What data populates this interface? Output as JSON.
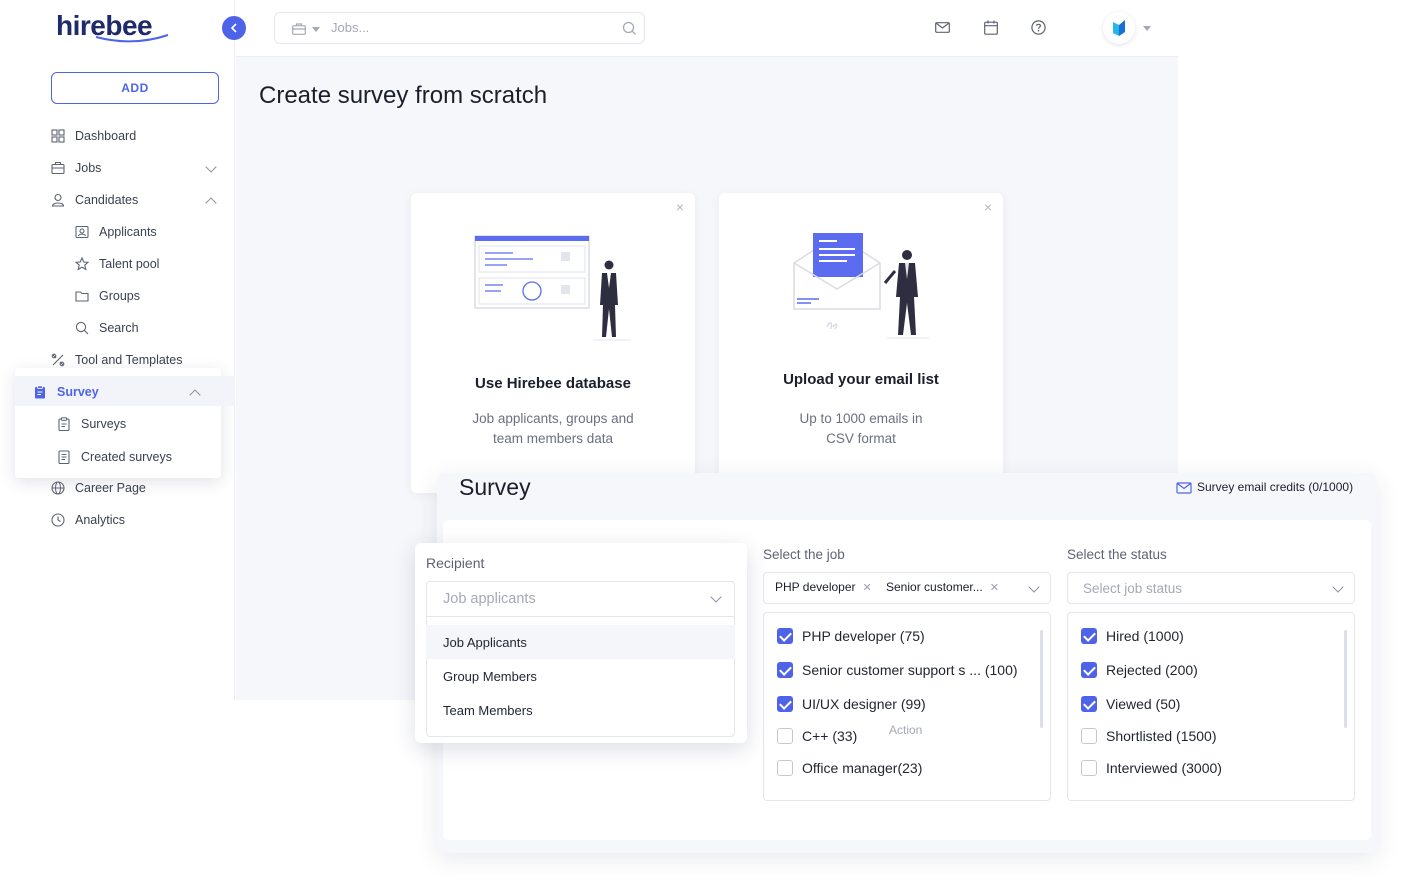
{
  "app": {
    "logo": "hirebee"
  },
  "sidebar": {
    "add_label": "ADD",
    "items": [
      {
        "label": "Dashboard",
        "icon": "grid-icon"
      },
      {
        "label": "Jobs",
        "icon": "briefcase-icon"
      },
      {
        "label": "Candidates",
        "icon": "user-icon"
      },
      {
        "label": "Applicants",
        "icon": "id-card-icon"
      },
      {
        "label": "Talent pool",
        "icon": "star-icon"
      },
      {
        "label": "Groups",
        "icon": "folder-icon"
      },
      {
        "label": "Search",
        "icon": "search-icon"
      },
      {
        "label": "Tool and Templates",
        "icon": "tools-icon"
      },
      {
        "label": "Career Page",
        "icon": "globe-icon"
      },
      {
        "label": "Analytics",
        "icon": "clock-icon"
      }
    ],
    "survey_menu": {
      "title": "Survey",
      "items": [
        {
          "label": "Surveys"
        },
        {
          "label": "Created surveys"
        }
      ]
    }
  },
  "topbar": {
    "search_placeholder": "Jobs...",
    "icons": [
      "mail-icon",
      "calendar-icon",
      "help-icon",
      "avatar"
    ]
  },
  "main": {
    "title": "Create survey from scratch",
    "cards": [
      {
        "title": "Use Hirebee database",
        "subtitle_line1": "Job applicants, groups and",
        "subtitle_line2": "team members data"
      },
      {
        "title": "Upload your email list",
        "subtitle_line1": "Up to 1000 emails in",
        "subtitle_line2": "CSV format"
      }
    ]
  },
  "survey": {
    "title": "Survey",
    "credits": "Survey email credits (0/1000)",
    "recipient": {
      "label": "Recipient",
      "placeholder": "Job applicants",
      "options": [
        "Job Applicants",
        "Group Members",
        "Team Members"
      ]
    },
    "job": {
      "label": "Select the job",
      "tags": [
        "PHP developer",
        "Senior customer..."
      ],
      "options": [
        {
          "label": "PHP developer (75)",
          "checked": true
        },
        {
          "label": "Senior customer support s ... (100)",
          "checked": true
        },
        {
          "label": "UI/UX designer (99)",
          "checked": true
        },
        {
          "label": "C++ (33)",
          "checked": false
        },
        {
          "label": "Office manager(23)",
          "checked": false
        }
      ],
      "action_label": "Action"
    },
    "status": {
      "label": "Select the status",
      "placeholder": "Select job status",
      "options": [
        {
          "label": "Hired (1000)",
          "checked": true
        },
        {
          "label": "Rejected (200)",
          "checked": true
        },
        {
          "label": "Viewed (50)",
          "checked": true
        },
        {
          "label": "Shortlisted (1500)",
          "checked": false
        },
        {
          "label": "Interviewed (3000)",
          "checked": false
        }
      ]
    }
  },
  "colors": {
    "accent": "#4f63e8",
    "text": "#1b1f2b",
    "muted": "#6b7080",
    "bg": "#f6f7fb"
  }
}
